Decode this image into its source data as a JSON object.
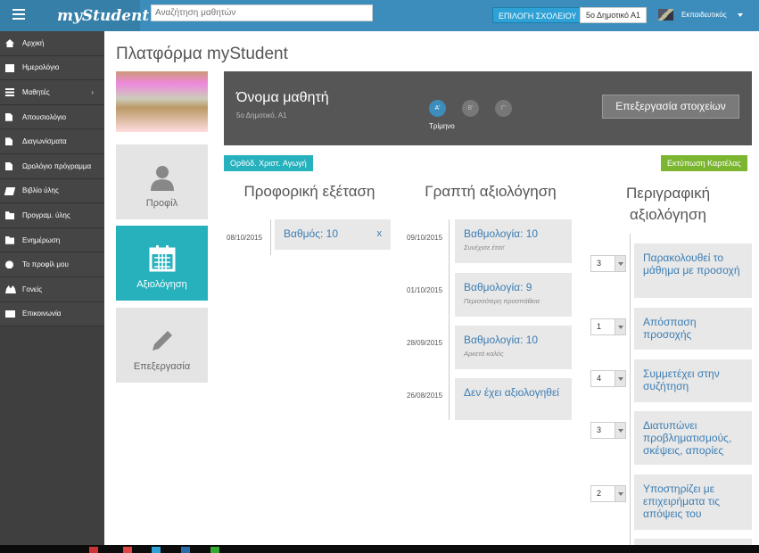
{
  "app": {
    "logo": "myStudent"
  },
  "search": {
    "placeholder": "Αναζήτηση μαθητών"
  },
  "topbar": {
    "school_button": "ΕΠΙΛΟΓΗ ΣΧΟΛΕΙΟΥ",
    "school_name": "5ο Δημοτικό Α1",
    "user": "Εκπαιδευτικός"
  },
  "sidebar": {
    "items": [
      {
        "label": "Αρχική",
        "icon": "home-icon"
      },
      {
        "label": "Ημερολόγιο",
        "icon": "calendar-icon"
      },
      {
        "label": "Μαθητές",
        "icon": "list-icon",
        "arrow": "›"
      },
      {
        "label": "Απουσιολόγιο",
        "icon": "file-icon"
      },
      {
        "label": "Διαγωνίσματα",
        "icon": "file-icon"
      },
      {
        "label": "Ωρολόγιο πρόγραμμα",
        "icon": "file-icon"
      },
      {
        "label": "Βιβλίο ύλης",
        "icon": "book-icon"
      },
      {
        "label": "Προγραμ. ύλης",
        "icon": "folder-icon"
      },
      {
        "label": "Ενημέρωση",
        "icon": "folder-icon"
      },
      {
        "label": "Το προφίλ μου",
        "icon": "user-icon"
      },
      {
        "label": "Γονείς",
        "icon": "users-icon"
      },
      {
        "label": "Επικοινωνία",
        "icon": "envelope-icon"
      }
    ]
  },
  "page": {
    "title": "Πλατφόρμα myStudent"
  },
  "tiles": {
    "profile": "Προφίλ",
    "evaluation": "Αξιολόγηση",
    "edit": "Επεξεργασία"
  },
  "student": {
    "name": "Όνομα μαθητή",
    "class": "5ο Δημοτικό, Α1",
    "terms": [
      "Α'",
      "Β'",
      "Γ'"
    ],
    "active_term": "Α'",
    "term_label": "Τρίμηνο",
    "edit_button": "Επεξεργασία στοιχείων"
  },
  "subject": {
    "tag": "Ορθόδ. Χριστ. Αγωγή",
    "print_button": "Εκτύπωση Καρτέλας"
  },
  "oral": {
    "title": "Προφορική εξέταση",
    "entries": [
      {
        "date": "08/10/2015",
        "text": "Βαθμός: 10",
        "remove": "x"
      }
    ]
  },
  "written": {
    "title": "Γραπτή αξιολόγηση",
    "entries": [
      {
        "date": "09/10/2015",
        "text": "Βαθμολογία: 10",
        "note": "Συνέχισε έτσι!"
      },
      {
        "date": "01/10/2015",
        "text": "Βαθμολογία: 9",
        "note": "Περισσότερη προσπάθεια"
      },
      {
        "date": "28/09/2015",
        "text": "Βαθμολογία: 10",
        "note": "Αρκετά καλός"
      },
      {
        "date": "26/08/2015",
        "text": "Δεν έχει αξιολογηθεί",
        "note": ""
      }
    ]
  },
  "descriptive": {
    "title": "Περιγραφική αξιολόγηση",
    "items": [
      {
        "value": "3",
        "text": "Παρακολουθεί το μάθημα με προσοχή"
      },
      {
        "value": "1",
        "text": "Απόσπαση προσοχής"
      },
      {
        "value": "4",
        "text": "Συμμετέχει στην συζήτηση"
      },
      {
        "value": "3",
        "text": "Διατυπώνει προβληματισμούς, σκέψεις, απορίες"
      },
      {
        "value": "2",
        "text": "Υποστηρίζει με επιχειρήματα τις απόψεις του"
      }
    ]
  }
}
